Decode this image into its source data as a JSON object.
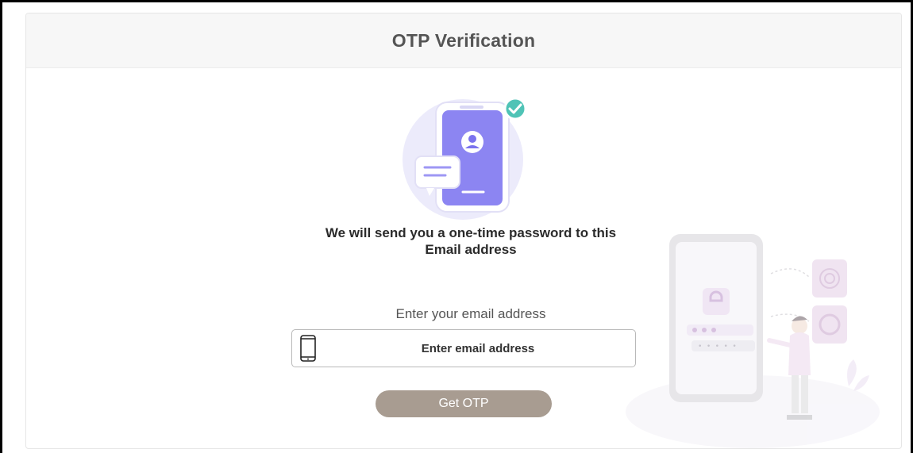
{
  "header": {
    "title": "OTP Verification"
  },
  "hero": {
    "message": "We will send you a one-time password to this Email address"
  },
  "form": {
    "label": "Enter your email address",
    "email_placeholder": "Enter email address",
    "input_icon": "phone-icon",
    "submit_label": "Get OTP"
  },
  "illustration": {
    "pin_text": "• • • • •"
  },
  "colors": {
    "accent_purple": "#7b73ee",
    "button": "#a89c91",
    "check_badge": "#4fc3b6",
    "header_bg": "#f7f7f7"
  }
}
